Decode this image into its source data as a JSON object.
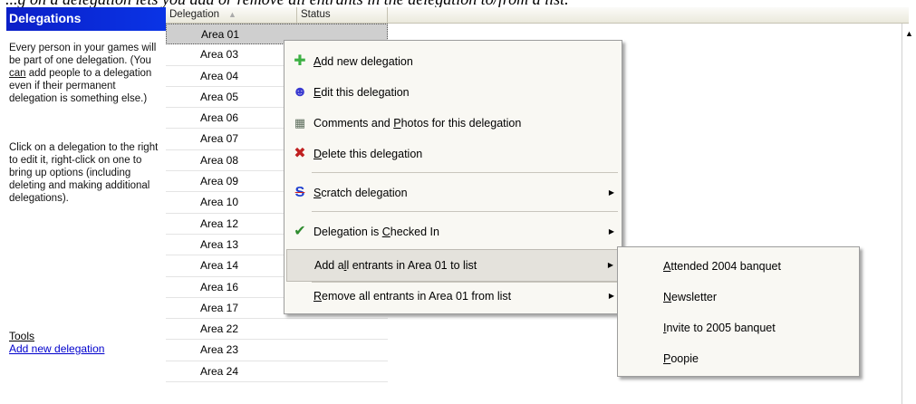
{
  "caption": "...g on a delegation lets you add or remove all entrants in the delegation to/from a list.",
  "left_panel": {
    "title": "Delegations",
    "para1_a": "Every person in your games will be part of one delegation. (You ",
    "para1_can": "can",
    "para1_b": " add people to a delegation even if their permanent delegation is something else.)",
    "para2": "Click on a delegation to the right to edit it, right-click on one to bring up options (including deleting and making additional delegations).",
    "tools_label": "Tools",
    "add_link": "Add new delegation"
  },
  "grid": {
    "columns": [
      "Delegation",
      "Status"
    ],
    "rows": [
      "Area 01",
      "Area 03",
      "Area 04",
      "Area 05",
      "Area 06",
      "Area 07",
      "Area 08",
      "Area 09",
      "Area 10",
      "Area 12",
      "Area 13",
      "Area 14",
      "Area 16",
      "Area 17",
      "Area 22",
      "Area 23",
      "Area 24"
    ],
    "selected_index": 0
  },
  "context_menu": {
    "items": [
      {
        "pre": "",
        "key": "A",
        "post": "dd new delegation",
        "icon": "plus-icon",
        "color": "#3cb043"
      },
      {
        "pre": "",
        "key": "E",
        "post": "dit this delegation",
        "icon": "edit-person-icon",
        "color": "#3a3ad0"
      },
      {
        "pre": "Comments and ",
        "key": "P",
        "post": "hotos for this delegation",
        "icon": "photos-icon",
        "color": "#607060"
      },
      {
        "pre": "",
        "key": "D",
        "post": "elete this delegation",
        "icon": "delete-x-icon",
        "color": "#c02020"
      },
      {
        "pre": "",
        "key": "S",
        "post": "cratch delegation",
        "icon": "scratch-icon",
        "color": "#2040d0"
      },
      {
        "pre": "Delegation is ",
        "key": "C",
        "post": "hecked In",
        "icon": "checkmark-icon",
        "color": "#2e8b2e"
      },
      {
        "pre": "Add a",
        "key": "l",
        "post": "l entrants in Area 01 to list",
        "icon": "",
        "color": ""
      },
      {
        "pre": "",
        "key": "R",
        "post": "emove all entrants in Area 01 from list",
        "icon": "",
        "color": ""
      }
    ]
  },
  "submenu": {
    "items": [
      {
        "pre": "",
        "key": "A",
        "post": "ttended 2004 banquet"
      },
      {
        "pre": "",
        "key": "N",
        "post": "ewsletter"
      },
      {
        "pre": "",
        "key": "I",
        "post": "nvite to 2005 banquet"
      },
      {
        "pre": "",
        "key": "P",
        "post": "oopie"
      }
    ]
  }
}
